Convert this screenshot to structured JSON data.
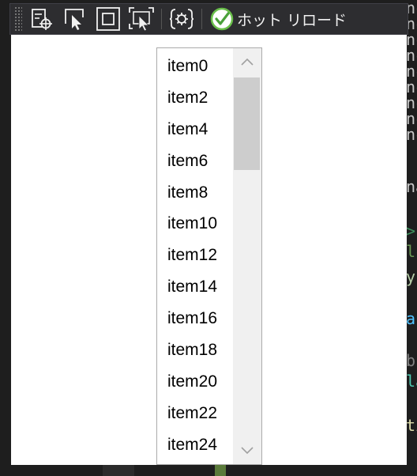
{
  "toolbar": {
    "buttons": [
      {
        "icon": "live-visual-tree-icon"
      },
      {
        "icon": "select-element-icon"
      },
      {
        "icon": "display-layout-adorners-icon"
      },
      {
        "icon": "track-focused-element-icon"
      },
      {
        "icon": "binding-failures-icon"
      }
    ],
    "hot_reload_label": "ホット リロード",
    "hot_reload_status_color": "#6abf4b"
  },
  "listbox": {
    "items": [
      "item0",
      "item2",
      "item4",
      "item6",
      "item8",
      "item10",
      "item12",
      "item14",
      "item16",
      "item18",
      "item20",
      "item22",
      "item24"
    ],
    "scroll_position": 0.0
  },
  "colors": {
    "toolbar_bg": "#2d2d30",
    "window_bg": "#ffffff",
    "scrollbar_track": "#f0f0f0",
    "scrollbar_thumb": "#cdcdcd"
  }
}
